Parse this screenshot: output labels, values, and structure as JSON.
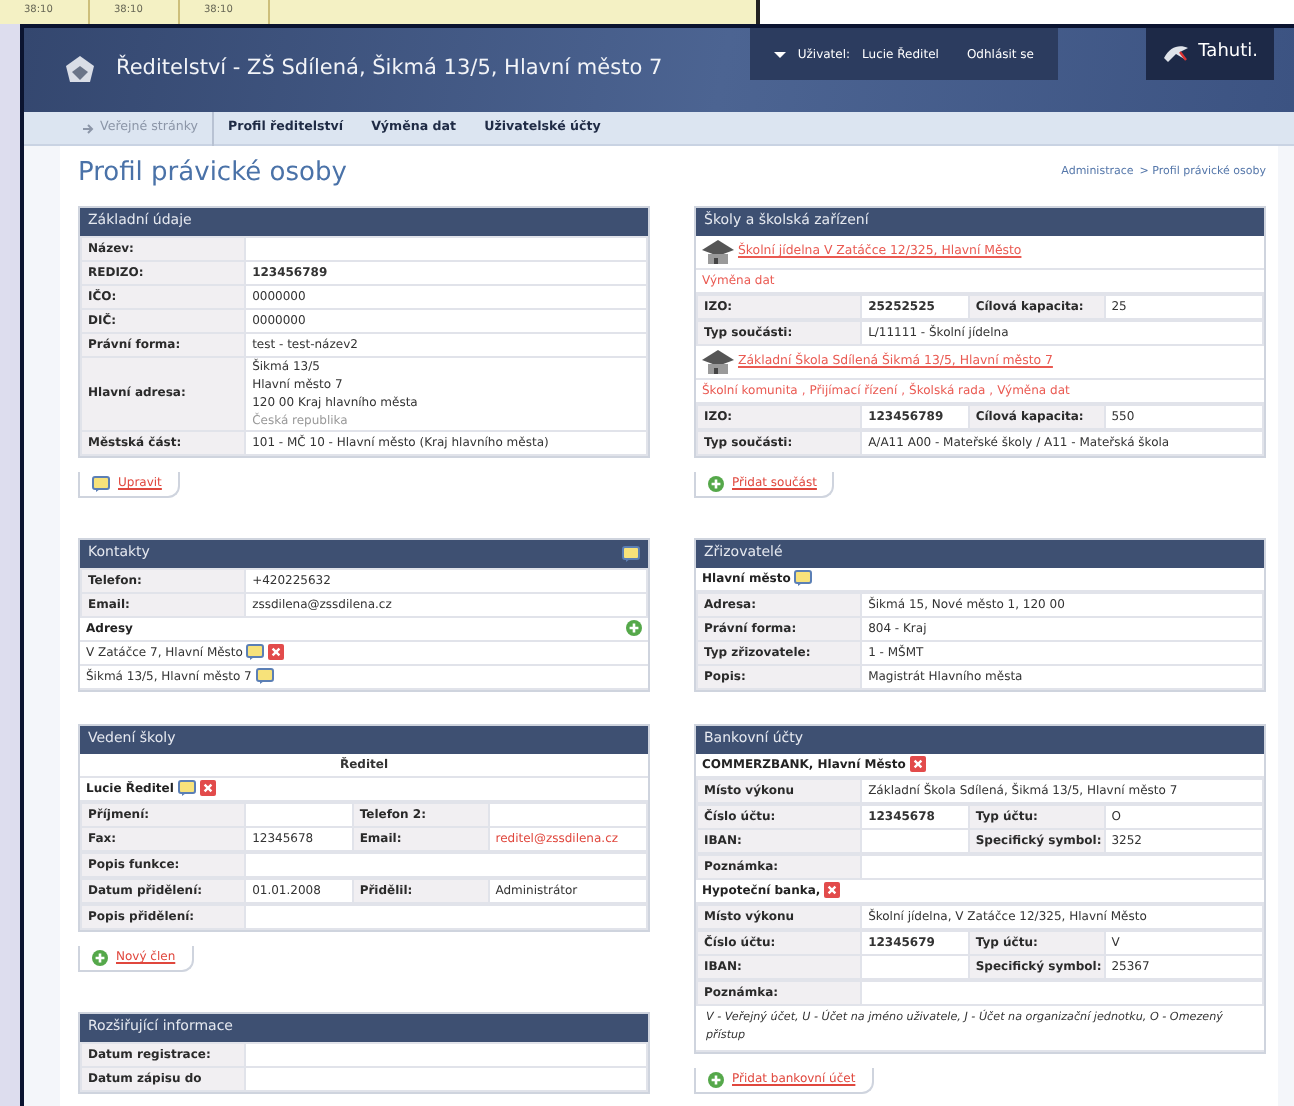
{
  "background_window": {
    "cells": [
      "38:10",
      "38:10",
      "38:10"
    ]
  },
  "header": {
    "title": "Ředitelství - ZŠ Sdílená, Šikmá 13/5, Hlavní město 7",
    "user_label": "Uživatel:",
    "user_name": "Lucie Ředitel",
    "logout": "Odhlásit se",
    "brand": "Tahuti."
  },
  "nav": [
    {
      "label": "Veřejné stránky",
      "kind": "public"
    },
    {
      "label": "Profil ředitelství",
      "kind": "main"
    },
    {
      "label": "Výměna dat",
      "kind": "main"
    },
    {
      "label": "Uživatelské účty",
      "kind": "main"
    }
  ],
  "page_title": "Profil právické osoby",
  "breadcrumb": [
    "Administrace",
    "> Profil právické osoby"
  ],
  "columns": [
    {
      "panels": [
        {
          "title": "Základní údaje",
          "blocks": [
            {
              "kind": "rows",
              "rows": [
                {
                  "cells": [
                    {
                      "kind": "label",
                      "text": "Název:"
                    },
                    {
                      "kind": "value"
                    }
                  ]
                },
                {
                  "cells": [
                    {
                      "kind": "label",
                      "text": "REDIZO:"
                    },
                    {
                      "kind": "strong",
                      "text": "123456789"
                    }
                  ]
                },
                {
                  "cells": [
                    {
                      "kind": "label",
                      "text": "IČO:"
                    },
                    {
                      "kind": "value",
                      "text": "0000000"
                    }
                  ]
                },
                {
                  "cells": [
                    {
                      "kind": "label",
                      "text": "DIČ:"
                    },
                    {
                      "kind": "value",
                      "text": "0000000"
                    }
                  ]
                },
                {
                  "cells": [
                    {
                      "kind": "label",
                      "text": "Právní forma:"
                    },
                    {
                      "kind": "value",
                      "text": "test - test-název2"
                    }
                  ]
                },
                {
                  "cells": [
                    {
                      "kind": "label",
                      "text": "Hlavní adresa:"
                    },
                    {
                      "kind": "value",
                      "lines": [
                        {
                          "text": "Šikmá 13/5",
                          "muted": false
                        },
                        {
                          "text": "Hlavní město 7",
                          "muted": false
                        },
                        {
                          "text": "120 00 Kraj hlavního města",
                          "muted": false
                        },
                        {
                          "text": "Česká republika",
                          "muted": true
                        }
                      ]
                    }
                  ]
                },
                {
                  "cells": [
                    {
                      "kind": "label",
                      "text": "Městská část:"
                    },
                    {
                      "kind": "value",
                      "text": "101 - MČ 10 - Hlavní město (Kraj hlavního města)"
                    }
                  ]
                }
              ]
            }
          ],
          "action": {
            "label": "Upravit",
            "kind": "edit"
          }
        },
        {
          "title": "Kontakty",
          "header_edit": true,
          "blocks": [
            {
              "kind": "rows",
              "rows": [
                {
                  "cells": [
                    {
                      "kind": "label",
                      "text": "Telefon:"
                    },
                    {
                      "kind": "value",
                      "text": "+420225632"
                    }
                  ]
                },
                {
                  "cells": [
                    {
                      "kind": "label",
                      "text": "Email:"
                    },
                    {
                      "kind": "value",
                      "text": "zssdilena@zssdilena.cz"
                    }
                  ]
                }
              ]
            },
            {
              "kind": "heading",
              "text": "Adresy",
              "add": true,
              "edit": false,
              "delete": false
            },
            {
              "kind": "item",
              "text": "V Zatáčce 7, Hlavní Město",
              "add": false,
              "edit": true,
              "delete": true
            },
            {
              "kind": "item",
              "text": "Šikmá 13/5, Hlavní město 7",
              "add": false,
              "edit": true,
              "delete": false
            }
          ]
        },
        {
          "title": "Vedení školy",
          "blocks": [
            {
              "kind": "role",
              "text": "Ředitel"
            },
            {
              "kind": "heading",
              "text": "Lucie Ředitel",
              "add": false,
              "edit": true,
              "delete": true
            },
            {
              "kind": "rows",
              "rows": [
                {
                  "cells": [
                    {
                      "kind": "label",
                      "text": "Příjmení:"
                    },
                    {
                      "kind": "value"
                    },
                    {
                      "kind": "label",
                      "text": "Telefon 2:"
                    },
                    {
                      "kind": "value"
                    }
                  ]
                },
                {
                  "cells": [
                    {
                      "kind": "label",
                      "text": "Fax:"
                    },
                    {
                      "kind": "value",
                      "text": "12345678"
                    },
                    {
                      "kind": "label",
                      "text": "Email:"
                    },
                    {
                      "kind": "link",
                      "text": "reditel@zssdilena.cz"
                    }
                  ]
                }
              ]
            },
            {
              "kind": "rows",
              "rows": [
                {
                  "cells": [
                    {
                      "kind": "label",
                      "text": "Popis funkce:"
                    },
                    {
                      "kind": "value"
                    }
                  ]
                }
              ]
            },
            {
              "kind": "rows",
              "rows": [
                {
                  "cells": [
                    {
                      "kind": "label",
                      "text": "Datum přidělení:"
                    },
                    {
                      "kind": "value",
                      "text": "01.01.2008"
                    },
                    {
                      "kind": "label",
                      "text": "Přidělil:"
                    },
                    {
                      "kind": "value",
                      "text": "Administrátor"
                    }
                  ]
                }
              ]
            },
            {
              "kind": "rows",
              "rows": [
                {
                  "cells": [
                    {
                      "kind": "label",
                      "text": "Popis přidělení:"
                    },
                    {
                      "kind": "value"
                    }
                  ]
                }
              ]
            }
          ],
          "action": {
            "label": "Nový člen",
            "kind": "add"
          }
        },
        {
          "title": "Rozšiřující informace",
          "blocks": [
            {
              "kind": "rows",
              "rows": [
                {
                  "cells": [
                    {
                      "kind": "label",
                      "text": "Datum registrace:"
                    },
                    {
                      "kind": "value"
                    }
                  ]
                },
                {
                  "cells": [
                    {
                      "kind": "label",
                      "text": "Datum zápisu do"
                    },
                    {
                      "kind": "value"
                    }
                  ]
                }
              ]
            }
          ]
        }
      ]
    },
    {
      "panels": [
        {
          "title": "Školy a školská zařízení",
          "blocks": [
            {
              "kind": "facility",
              "text": "Školní jídelna V Zatáčce 12/325, Hlavní Město"
            },
            {
              "kind": "links",
              "links": [
                "Výměna dat"
              ]
            },
            {
              "kind": "rows",
              "rows": [
                {
                  "cells": [
                    {
                      "kind": "label",
                      "text": "IZO:"
                    },
                    {
                      "kind": "strong",
                      "text": "25252525"
                    },
                    {
                      "kind": "label",
                      "text": "Cílová kapacita:"
                    },
                    {
                      "kind": "value",
                      "text": "25"
                    }
                  ]
                }
              ]
            },
            {
              "kind": "rows",
              "rows": [
                {
                  "cells": [
                    {
                      "kind": "label",
                      "text": "Typ součásti:"
                    },
                    {
                      "kind": "value",
                      "text": "L/11111 - Školní jídelna"
                    }
                  ]
                }
              ]
            },
            {
              "kind": "facility",
              "text": "Základní Škola Sdílená Šikmá 13/5, Hlavní město 7"
            },
            {
              "kind": "links",
              "separator": ",",
              "links": [
                "Školní komunita",
                "Přijímací řízení",
                "Školská rada",
                "Výměna dat"
              ]
            },
            {
              "kind": "rows",
              "rows": [
                {
                  "cells": [
                    {
                      "kind": "label",
                      "text": "IZO:"
                    },
                    {
                      "kind": "strong",
                      "text": "123456789"
                    },
                    {
                      "kind": "label",
                      "text": "Cílová kapacita:"
                    },
                    {
                      "kind": "value",
                      "text": "550"
                    }
                  ]
                }
              ]
            },
            {
              "kind": "rows",
              "rows": [
                {
                  "cells": [
                    {
                      "kind": "label",
                      "text": "Typ součásti:"
                    },
                    {
                      "kind": "value",
                      "text": "A/A11 A00 - Mateřské školy / A11 - Mateřská škola"
                    }
                  ]
                }
              ]
            }
          ],
          "action": {
            "label": "Přidat součást",
            "kind": "add"
          }
        },
        {
          "title": "Zřizovatelé",
          "blocks": [
            {
              "kind": "heading",
              "text": "Hlavní město",
              "add": false,
              "edit": true,
              "delete": false
            },
            {
              "kind": "rows",
              "rows": [
                {
                  "cells": [
                    {
                      "kind": "label",
                      "text": "Adresa:"
                    },
                    {
                      "kind": "value",
                      "text": "Šikmá 15, Nové město 1, 120 00"
                    }
                  ]
                },
                {
                  "cells": [
                    {
                      "kind": "label",
                      "text": "Právní forma:"
                    },
                    {
                      "kind": "value",
                      "text": "804 - Kraj"
                    }
                  ]
                },
                {
                  "cells": [
                    {
                      "kind": "label",
                      "text": "Typ zřizovatele:"
                    },
                    {
                      "kind": "value",
                      "text": "1 - MŠMT"
                    }
                  ]
                },
                {
                  "cells": [
                    {
                      "kind": "label",
                      "text": "Popis:"
                    },
                    {
                      "kind": "value",
                      "text": "Magistrát Hlavního města"
                    }
                  ]
                }
              ]
            }
          ]
        },
        {
          "title": "Bankovní účty",
          "blocks": [
            {
              "kind": "heading",
              "text": "COMMERZBANK, Hlavní Město",
              "add": false,
              "edit": false,
              "delete": true
            },
            {
              "kind": "rows",
              "rows": [
                {
                  "cells": [
                    {
                      "kind": "label",
                      "text": "Místo výkonu"
                    },
                    {
                      "kind": "value",
                      "text": "Základní Škola Sdílená, Šikmá 13/5, Hlavní město 7"
                    }
                  ]
                }
              ]
            },
            {
              "kind": "rows",
              "rows": [
                {
                  "cells": [
                    {
                      "kind": "label",
                      "text": "Číslo účtu:"
                    },
                    {
                      "kind": "strong",
                      "text": "12345678"
                    },
                    {
                      "kind": "label",
                      "text": "Typ účtu:"
                    },
                    {
                      "kind": "value",
                      "text": "O"
                    }
                  ]
                },
                {
                  "cells": [
                    {
                      "kind": "label",
                      "text": "IBAN:"
                    },
                    {
                      "kind": "value"
                    },
                    {
                      "kind": "label",
                      "text": "Specifický symbol:"
                    },
                    {
                      "kind": "value",
                      "text": "3252"
                    }
                  ]
                }
              ]
            },
            {
              "kind": "rows",
              "rows": [
                {
                  "cells": [
                    {
                      "kind": "label",
                      "text": "Poznámka:"
                    },
                    {
                      "kind": "value"
                    }
                  ]
                }
              ]
            },
            {
              "kind": "heading",
              "text": "Hypoteční banka,",
              "add": false,
              "edit": false,
              "delete": true
            },
            {
              "kind": "rows",
              "rows": [
                {
                  "cells": [
                    {
                      "kind": "label",
                      "text": "Místo výkonu"
                    },
                    {
                      "kind": "value",
                      "text": "Školní jídelna, V Zatáčce 12/325, Hlavní Město"
                    }
                  ]
                }
              ]
            },
            {
              "kind": "rows",
              "rows": [
                {
                  "cells": [
                    {
                      "kind": "label",
                      "text": "Číslo účtu:"
                    },
                    {
                      "kind": "strong",
                      "text": "12345679"
                    },
                    {
                      "kind": "label",
                      "text": "Typ účtu:"
                    },
                    {
                      "kind": "value",
                      "text": "V"
                    }
                  ]
                },
                {
                  "cells": [
                    {
                      "kind": "label",
                      "text": "IBAN:"
                    },
                    {
                      "kind": "value"
                    },
                    {
                      "kind": "label",
                      "text": "Specifický symbol:"
                    },
                    {
                      "kind": "value",
                      "text": "25367"
                    }
                  ]
                }
              ]
            },
            {
              "kind": "rows",
              "rows": [
                {
                  "cells": [
                    {
                      "kind": "label",
                      "text": "Poznámka:"
                    },
                    {
                      "kind": "value"
                    }
                  ]
                }
              ]
            },
            {
              "kind": "note",
              "text": "V - Veřejný účet, U - Účet na jméno uživatele, J - Účet na organizační jednotku, O - Omezený přístup"
            }
          ],
          "action": {
            "label": "Přidat bankovní účet",
            "kind": "add"
          }
        }
      ]
    }
  ]
}
